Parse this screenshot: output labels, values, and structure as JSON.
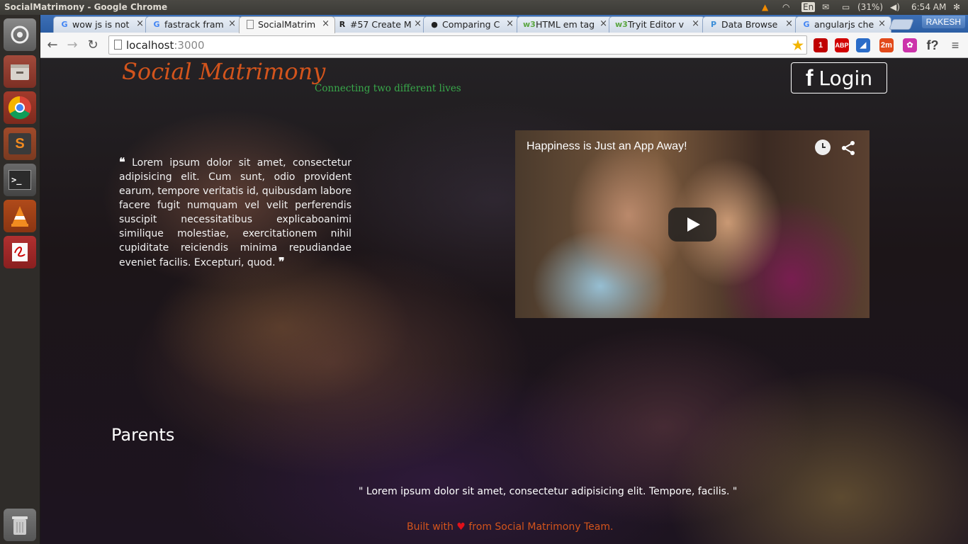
{
  "os": {
    "window_title": "SocialMatrimony - Google Chrome",
    "indicators": {
      "keyboard": "En",
      "battery": "(31%)",
      "time": "6:54 AM"
    },
    "launcher": [
      {
        "name": "dash-home-icon"
      },
      {
        "name": "files-icon"
      },
      {
        "name": "chrome-icon"
      },
      {
        "name": "sublime-text-icon",
        "letter": "S"
      },
      {
        "name": "terminal-icon",
        "letter": ">_"
      },
      {
        "name": "vlc-icon"
      },
      {
        "name": "text-editor-icon"
      },
      {
        "name": "trash-icon"
      }
    ]
  },
  "browser": {
    "tabs": [
      {
        "label": "wow js is not",
        "favicon": "G",
        "favicon_color": "#4285f4",
        "active": false
      },
      {
        "label": "fastrack fram",
        "favicon": "G",
        "favicon_color": "#4285f4",
        "active": false
      },
      {
        "label": "SocialMatrim",
        "favicon": "",
        "favicon_color": "#777777",
        "active": true
      },
      {
        "label": "#57 Create M",
        "favicon": "R",
        "favicon_color": "#222222",
        "active": false
      },
      {
        "label": "Comparing C",
        "favicon": "●",
        "favicon_color": "#222222",
        "active": false
      },
      {
        "label": "HTML em tag",
        "favicon": "w3",
        "favicon_color": "#5ba641",
        "active": false
      },
      {
        "label": "Tryit Editor v",
        "favicon": "w3",
        "favicon_color": "#5ba641",
        "active": false
      },
      {
        "label": "Data Browse",
        "favicon": "P",
        "favicon_color": "#3b8ed8",
        "active": false
      },
      {
        "label": "angularjs che",
        "favicon": "G",
        "favicon_color": "#4285f4",
        "active": false
      }
    ],
    "profile_name": "RAKESH",
    "url_host": "localhost",
    "url_port": ":3000",
    "extensions": [
      {
        "name": "bookmark-star-icon",
        "label": "★",
        "color": "#f2b400"
      },
      {
        "name": "lastpass-extension-icon",
        "label": "1",
        "color": "#c00000"
      },
      {
        "name": "adblock-plus-icon",
        "label": "ABP",
        "color": "#d20000"
      },
      {
        "name": "pin-extension-icon",
        "label": "◢",
        "color": "#2a6cc8"
      },
      {
        "name": "timer-extension-icon",
        "label": "2m",
        "color": "#e24a1a"
      },
      {
        "name": "color-wheel-icon",
        "label": "✿",
        "color": "#cc33aa"
      },
      {
        "name": "font-extension-icon",
        "label": "f?",
        "color": "#444444"
      },
      {
        "name": "chrome-menu-icon",
        "label": "≡",
        "color": "#555555"
      }
    ]
  },
  "page": {
    "brand": "Social Matrimony",
    "tagline": "Connecting two different lives",
    "login_fb": "f",
    "login_label": "Login",
    "quote": "Lorem ipsum dolor sit amet, consectetur adipisicing elit. Cum sunt, odio provident earum, tempore veritatis id, quibusdam labore facere fugit numquam vel velit perferendis suscipit necessitatibus explicaboanimi similique molestiae, exercitationem nihil cupiditate reiciendis minima repudiandae eveniet facilis. Excepturi, quod.",
    "quote_open": "❝",
    "quote_close": "❞",
    "video_title": "Happiness is Just an App Away!",
    "section_title": "Parents",
    "parent_quote": "\" Lorem ipsum dolor sit amet, consectetur adipisicing elit. Tempore, facilis. \"",
    "footer_before": "Built with",
    "footer_heart": "♥",
    "footer_after": "from Social Matrimony Team."
  }
}
